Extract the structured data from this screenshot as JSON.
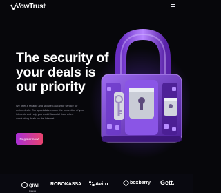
{
  "header": {
    "brand": "VowTrust",
    "logo_icon": "v-logo-icon",
    "menu_icon": "menu-icon"
  },
  "hero": {
    "title": "The security of your deals is our priority",
    "description": "We offer a reliable and secure Guarantor service for online deals. Our specialists ensure the protection of your interests and help you avoid financial risks when conducting deals on the Internet.",
    "cta_label": "Register now!",
    "illustration": "padlock-illustration"
  },
  "colors": {
    "background": "#07070b",
    "cta_start": "#a92fd6",
    "cta_end": "#e8436e",
    "lock_purple": "#8b4fe0",
    "muted_text": "#9c9ca8"
  },
  "partners": {
    "items": [
      {
        "name": "QIWI",
        "sub": "Кошелек"
      },
      {
        "name": "ROBOKASSA"
      },
      {
        "name": "Avito"
      },
      {
        "name": "boxberry"
      },
      {
        "name": "Gett."
      }
    ]
  }
}
